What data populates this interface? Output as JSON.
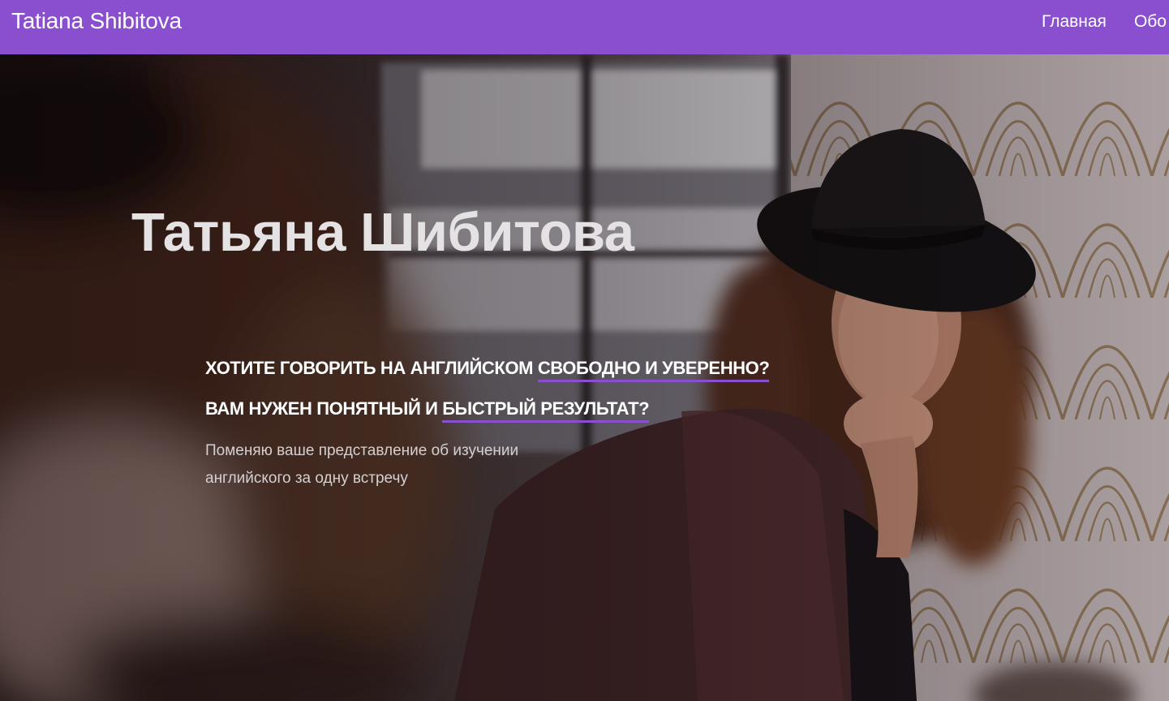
{
  "header": {
    "brand": "Tatiana Shibitova",
    "nav": [
      {
        "label": "Главная"
      },
      {
        "label": "Обо"
      }
    ],
    "background_color": "#8a4fcf"
  },
  "hero": {
    "title": "Татьяна Шибитова",
    "question_1": {
      "before": "Хотите говорить на английском ",
      "highlight": "свободно и уверенно?"
    },
    "question_2": {
      "before": "Вам нужен понятный и ",
      "highlight": "быстрый результат?"
    },
    "subtitle": "Поменяю ваше представление об изучении английского за одну встречу",
    "accent_color": "#8a4fcf"
  }
}
